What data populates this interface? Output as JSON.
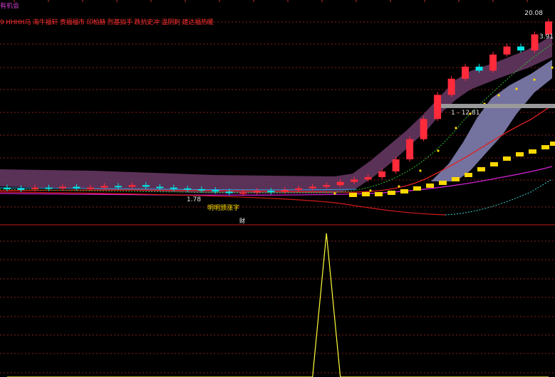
{
  "header": {
    "title": "有机会",
    "legend": "9 HHHH马 海牛福轩 贵福福市 印柏赫 烈基拟手 跌抗史冲 温阴刺 建达福热暖"
  },
  "prices": {
    "high": "20.08",
    "high_2": "3.91",
    "mid": "1 - 12.81",
    "low": "1.78"
  },
  "annotations": {
    "low_note": "明明颁涨字",
    "lower_panel_label": "财"
  },
  "colors": {
    "background": "#000000",
    "up_candle": "#ff2a3a",
    "down_candle": "#00e5e5",
    "band_fill": "#6a3a66",
    "cloud_fill": "#7a78a8",
    "yellow_dots": "#ffd800",
    "grid": "#8a1c1c",
    "signal_line": "#ffff3c"
  },
  "chart_data": [
    {
      "type": "candlestick",
      "title": "",
      "candles": [
        {
          "o": 1.85,
          "c": 1.83
        },
        {
          "o": 1.84,
          "c": 1.82
        },
        {
          "o": 1.83,
          "c": 1.85
        },
        {
          "o": 1.85,
          "c": 1.84
        },
        {
          "o": 1.84,
          "c": 1.86
        },
        {
          "o": 1.86,
          "c": 1.84
        },
        {
          "o": 1.84,
          "c": 1.85
        },
        {
          "o": 1.85,
          "c": 1.87
        },
        {
          "o": 1.87,
          "c": 1.86
        },
        {
          "o": 1.86,
          "c": 1.88
        },
        {
          "o": 1.88,
          "c": 1.86
        },
        {
          "o": 1.86,
          "c": 1.85
        },
        {
          "o": 1.85,
          "c": 1.84
        },
        {
          "o": 1.84,
          "c": 1.83
        },
        {
          "o": 1.83,
          "c": 1.82
        },
        {
          "o": 1.82,
          "c": 1.8
        },
        {
          "o": 1.8,
          "c": 1.78
        },
        {
          "o": 1.78,
          "c": 1.79
        },
        {
          "o": 1.79,
          "c": 1.81
        },
        {
          "o": 1.81,
          "c": 1.8
        },
        {
          "o": 1.8,
          "c": 1.82
        },
        {
          "o": 1.82,
          "c": 1.84
        },
        {
          "o": 1.84,
          "c": 1.86
        },
        {
          "o": 1.86,
          "c": 1.88
        },
        {
          "o": 1.88,
          "c": 1.92
        },
        {
          "o": 1.92,
          "c": 1.95
        },
        {
          "o": 1.95,
          "c": 1.98
        },
        {
          "o": 1.98,
          "c": 2.05
        },
        {
          "o": 2.05,
          "c": 2.2
        },
        {
          "o": 2.2,
          "c": 2.45
        },
        {
          "o": 2.45,
          "c": 2.7
        },
        {
          "o": 2.7,
          "c": 3.0
        },
        {
          "o": 3.0,
          "c": 3.2
        },
        {
          "o": 3.2,
          "c": 3.35
        },
        {
          "o": 3.35,
          "c": 3.3
        },
        {
          "o": 3.3,
          "c": 3.5
        },
        {
          "o": 3.5,
          "c": 3.6
        },
        {
          "o": 3.6,
          "c": 3.55
        },
        {
          "o": 3.55,
          "c": 3.75
        },
        {
          "o": 3.75,
          "c": 3.91
        }
      ],
      "ylim": [
        1.6,
        4.0
      ]
    },
    {
      "type": "line",
      "title": "",
      "series": [
        {
          "values": [
            0,
            0,
            0,
            0,
            0,
            0,
            0,
            0,
            0,
            0,
            0,
            0,
            0,
            0,
            0,
            0,
            0,
            0,
            0,
            0,
            0,
            0,
            0,
            1,
            0,
            0,
            0,
            0,
            0,
            0,
            0,
            0,
            0,
            0,
            0,
            0,
            0,
            0,
            0,
            0
          ]
        }
      ],
      "ylim": [
        0,
        1
      ]
    }
  ]
}
